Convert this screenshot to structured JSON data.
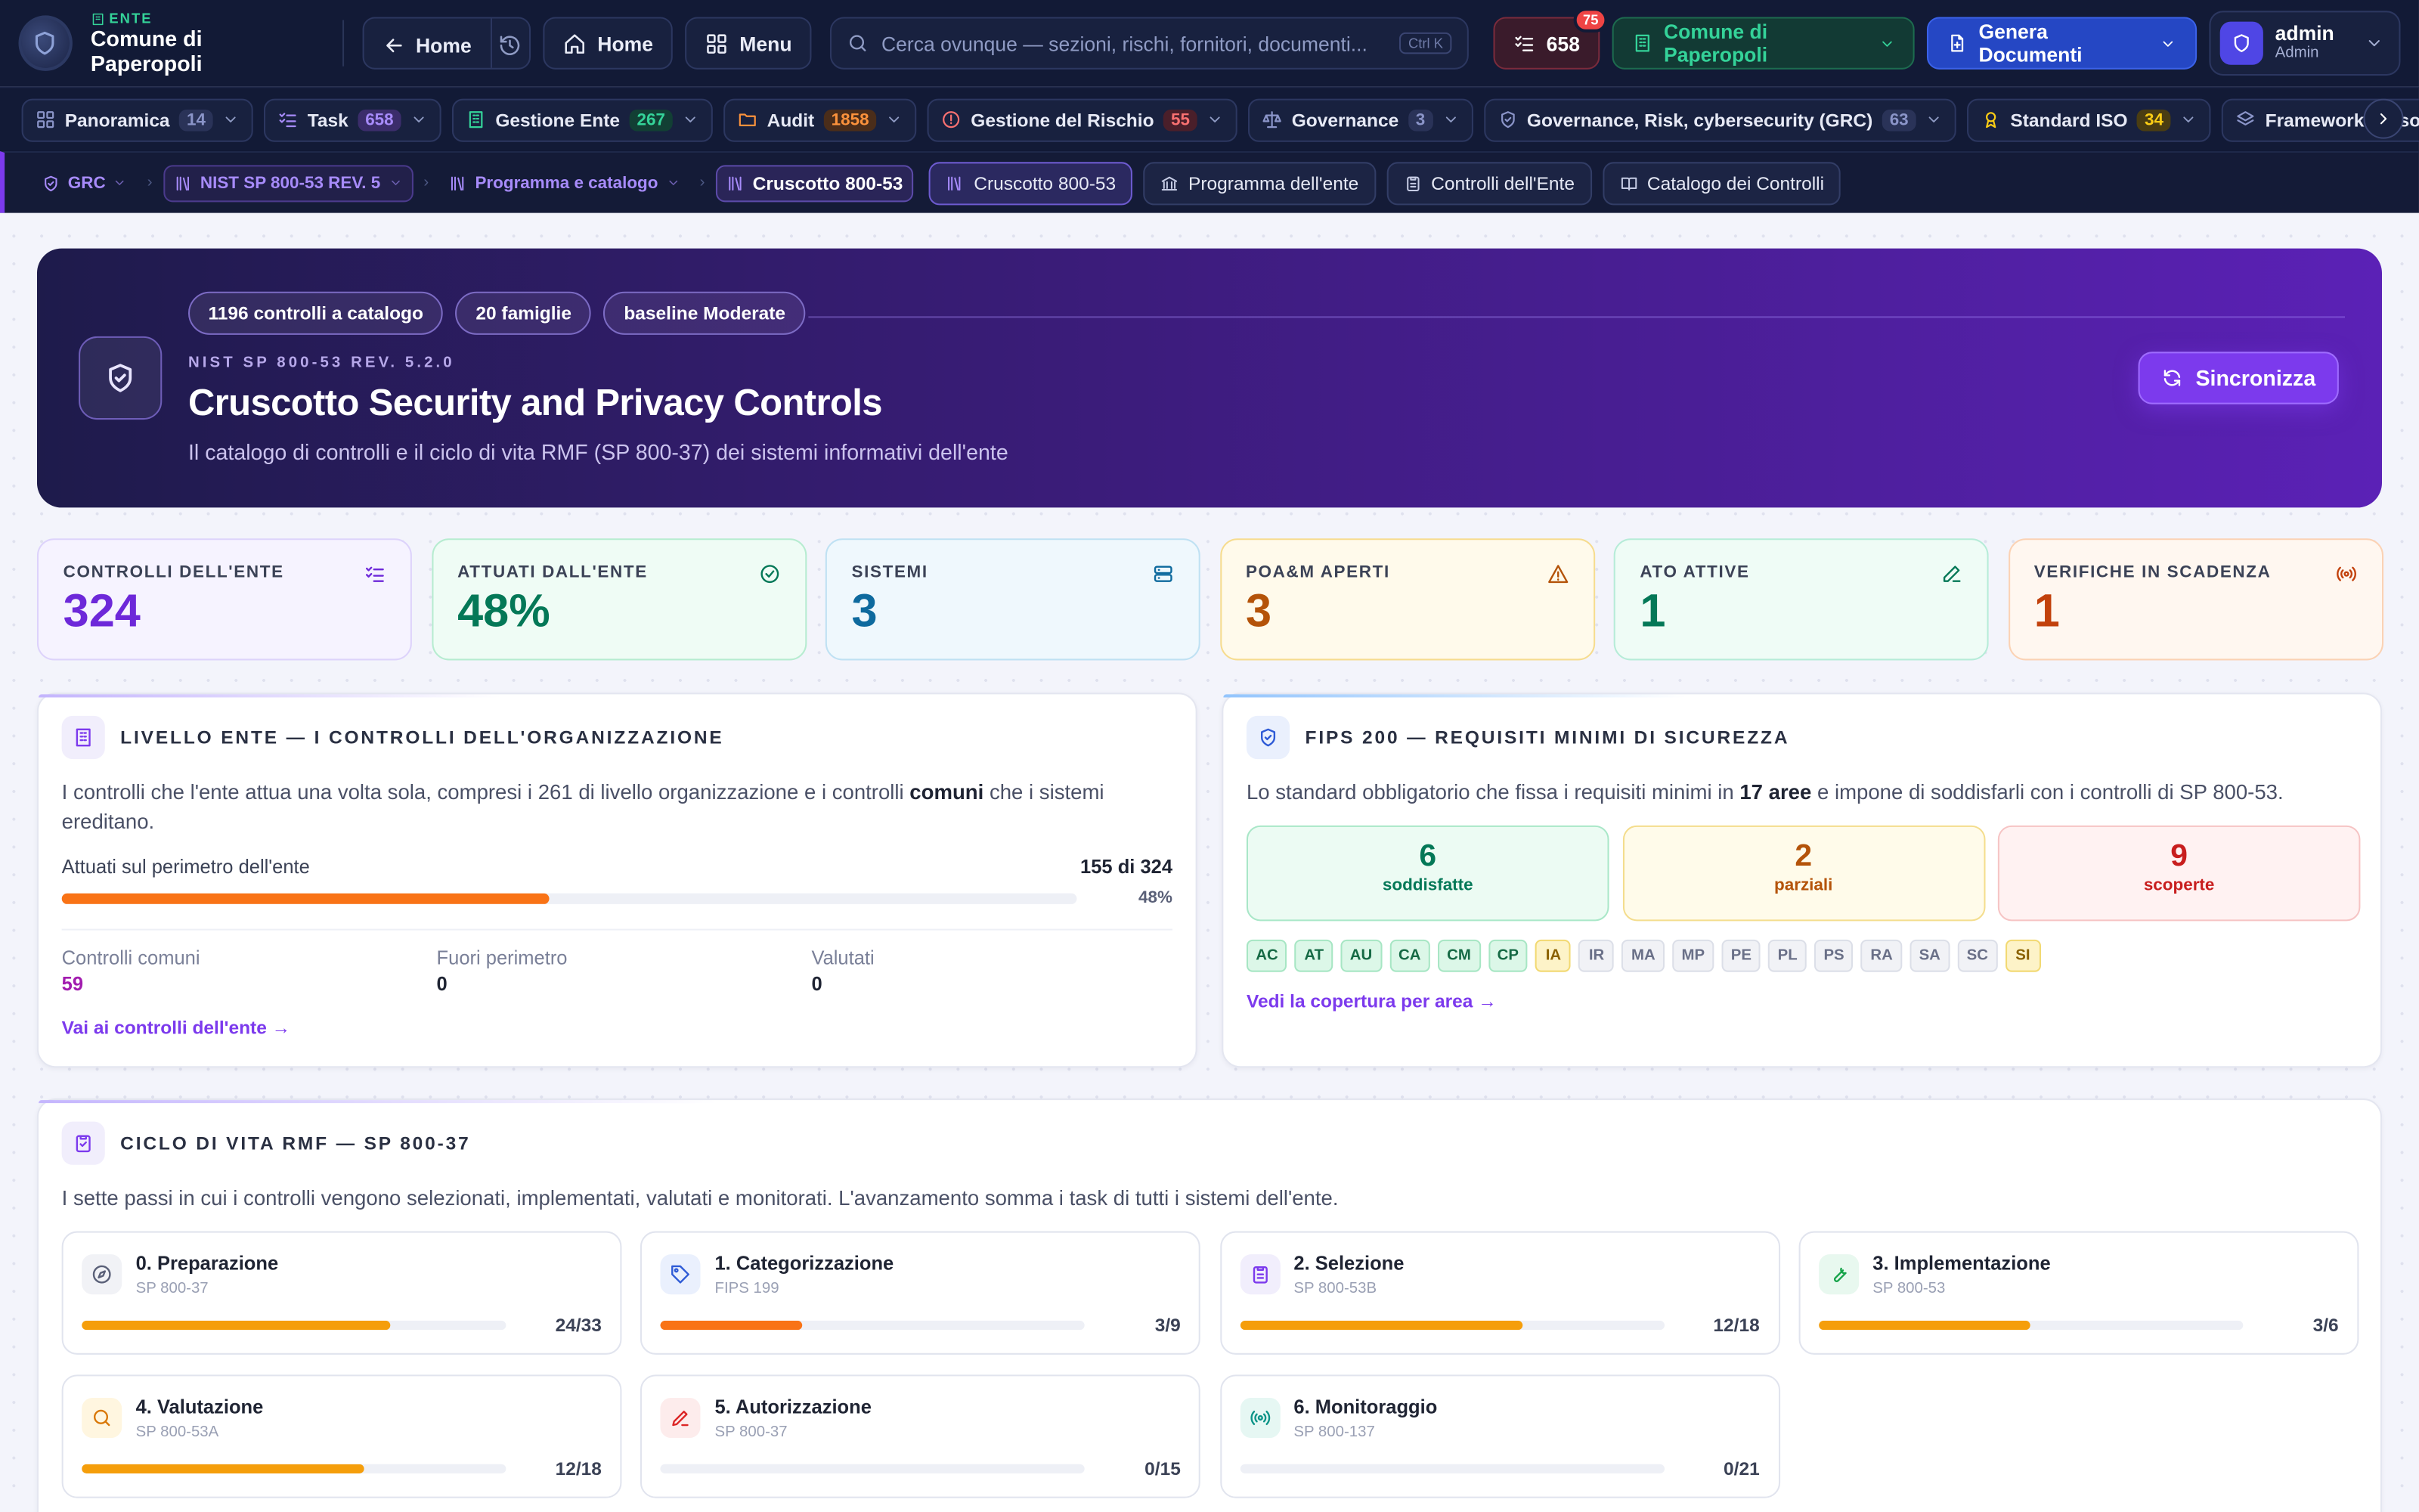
{
  "topbar": {
    "brand_tag": "ENTE",
    "brand_name": "Comune di Paperopoli",
    "home_back_label": "Home",
    "home_label": "Home",
    "menu_label": "Menu",
    "search_placeholder": "Cerca ovunque — sezioni, rischi, fornitori, documenti...",
    "search_shortcut": "Ctrl K",
    "tasks_count": "658",
    "tasks_badge": "75",
    "ente_label": "Comune di Paperopoli",
    "generate_label": "Genera Documenti",
    "user_name": "admin",
    "user_role": "Admin"
  },
  "modules": [
    {
      "label": "Panoramica",
      "count": "14",
      "icon": "grid-icon",
      "color": "#8b95c9",
      "cbg": "#2a3358"
    },
    {
      "label": "Task",
      "count": "658",
      "icon": "checklist-icon",
      "color": "#a78bfa",
      "cbg": "#3b2d6b"
    },
    {
      "label": "Gestione Ente",
      "count": "267",
      "icon": "building-icon",
      "color": "#34d399",
      "cbg": "#123f34"
    },
    {
      "label": "Audit",
      "count": "1858",
      "icon": "folder-icon",
      "color": "#fb923c",
      "cbg": "#4a2d1a"
    },
    {
      "label": "Gestione del Rischio",
      "count": "55",
      "icon": "alert-circle-icon",
      "color": "#f87171",
      "cbg": "#4a1f2a"
    },
    {
      "label": "Governance",
      "count": "3",
      "icon": "scale-icon",
      "color": "#8b95c9",
      "cbg": "#2a3358"
    },
    {
      "label": "Governance, Risk, cybersecurity (GRC)",
      "count": "63",
      "icon": "shield-check-icon",
      "color": "#8b95c9",
      "cbg": "#2a3358"
    },
    {
      "label": "Standard ISO",
      "count": "34",
      "icon": "award-icon",
      "color": "#facc15",
      "cbg": "#4a3d12"
    },
    {
      "label": "Framework Personalizzati",
      "count": "",
      "icon": "layers-icon",
      "color": "#8b95c9",
      "cbg": "#2a3358"
    }
  ],
  "breadcrumb": {
    "grc": "GRC",
    "nist": "NIST SP 800-53 REV. 5",
    "program": "Programma e catalogo",
    "current": "Cruscotto 800-53"
  },
  "quicklinks": [
    {
      "label": "Cruscotto 800-53",
      "icon": "library-icon"
    },
    {
      "label": "Programma dell'ente",
      "icon": "bank-icon"
    },
    {
      "label": "Controlli dell'Ente",
      "icon": "clipboard-icon"
    },
    {
      "label": "Catalogo dei Controlli",
      "icon": "book-icon"
    }
  ],
  "hero": {
    "tags": [
      "1196 controlli a catalogo",
      "20 famiglie",
      "baseline Moderate"
    ],
    "kicker": "NIST SP 800-53 REV. 5.2.0",
    "title": "Cruscotto Security and Privacy Controls",
    "subtitle": "Il catalogo di controlli e il ciclo di vita RMF (SP 800-37) dei sistemi informativi dell'ente",
    "sync_label": "Sincronizza"
  },
  "stats": [
    {
      "label": "CONTROLLI DELL'ENTE",
      "value": "324",
      "color": "#6d28d9",
      "bg": "#f6f3ff",
      "border": "#ddd3fb",
      "icon": "checklist-icon"
    },
    {
      "label": "ATTUATI DALL'ENTE",
      "value": "48%",
      "color": "#047857",
      "bg": "#effcf5",
      "border": "#b6ecd0",
      "icon": "check-circle-icon"
    },
    {
      "label": "SISTEMI",
      "value": "3",
      "color": "#0e6a9e",
      "bg": "#eff8fd",
      "border": "#bfe1f3",
      "icon": "server-icon"
    },
    {
      "label": "POA&M APERTI",
      "value": "3",
      "color": "#b45309",
      "bg": "#fffaeb",
      "border": "#f6dc8f",
      "icon": "warning-icon"
    },
    {
      "label": "ATO ATTIVE",
      "value": "1",
      "color": "#047857",
      "bg": "#effcf6",
      "border": "#b6ecd8",
      "icon": "pencil-icon"
    },
    {
      "label": "VERIFICHE IN SCADENZA",
      "value": "1",
      "color": "#c2410c",
      "bg": "#fff7f0",
      "border": "#fbd2b4",
      "icon": "broadcast-icon"
    }
  ],
  "ente": {
    "title": "LIVELLO ENTE — I CONTROLLI DELL'ORGANIZZAZIONE",
    "desc_pre": "I controlli che l'ente attua una volta sola, compresi i 261 di livello organizzazione e i controlli ",
    "desc_bold": "comuni",
    "desc_post": " che i sistemi ereditano.",
    "progress_label": "Attuati sul perimetro dell'ente",
    "progress_count": "155 di 324",
    "progress_pct": "48%",
    "progress_value": 0.48,
    "metrics": [
      {
        "label": "Controlli comuni",
        "value": "59",
        "color": "#a21caf"
      },
      {
        "label": "Fuori perimetro",
        "value": "0",
        "color": "#1f2433"
      },
      {
        "label": "Valutati",
        "value": "0",
        "color": "#1f2433"
      }
    ],
    "link": "Vai ai controlli dell'ente →"
  },
  "fips": {
    "title": "FIPS 200 — REQUISITI MINIMI DI SICUREZZA",
    "desc_pre": "Lo standard obbligatorio che fissa i requisiti minimi in ",
    "desc_bold": "17 aree",
    "desc_post": " e impone di soddisfarli con i controlli di SP 800-53.",
    "boxes": [
      {
        "value": "6",
        "label": "soddisfatte",
        "color": "#047857",
        "bg": "#ecfbf3",
        "border": "#a9e7c8"
      },
      {
        "value": "2",
        "label": "parziali",
        "color": "#b45309",
        "bg": "#fffbea",
        "border": "#f4dd8d"
      },
      {
        "value": "9",
        "label": "scoperte",
        "color": "#c81e1e",
        "bg": "#fff2f2",
        "border": "#f6c4c4"
      }
    ],
    "areas": [
      {
        "code": "AC",
        "status": "ok"
      },
      {
        "code": "AT",
        "status": "ok"
      },
      {
        "code": "AU",
        "status": "ok"
      },
      {
        "code": "CA",
        "status": "ok"
      },
      {
        "code": "CM",
        "status": "ok"
      },
      {
        "code": "CP",
        "status": "ok"
      },
      {
        "code": "IA",
        "status": "pa"
      },
      {
        "code": "IR",
        "status": "no"
      },
      {
        "code": "MA",
        "status": "no"
      },
      {
        "code": "MP",
        "status": "no"
      },
      {
        "code": "PE",
        "status": "no"
      },
      {
        "code": "PL",
        "status": "no"
      },
      {
        "code": "PS",
        "status": "no"
      },
      {
        "code": "RA",
        "status": "no"
      },
      {
        "code": "SA",
        "status": "no"
      },
      {
        "code": "SC",
        "status": "no"
      },
      {
        "code": "SI",
        "status": "pa"
      }
    ],
    "link": "Vedi la copertura per area →"
  },
  "rmf": {
    "title": "CICLO DI VITA RMF — SP 800-37",
    "desc": "I sette passi in cui i controlli vengono selezionati, implementati, valutati e monitorati. L'avanzamento somma i task di tutti i sistemi dell'ente.",
    "steps": [
      {
        "title": "0. Preparazione",
        "ref": "SP 800-37",
        "value": "24/33",
        "progress": 0.727,
        "icon": "compass-icon",
        "color": "#f59e0b",
        "ibg": "#f1f2f6",
        "ic": "#5a6078"
      },
      {
        "title": "1. Categorizzazione",
        "ref": "FIPS 199",
        "value": "3/9",
        "progress": 0.333,
        "icon": "tag-icon",
        "color": "#f97316",
        "ibg": "#eaf0fd",
        "ic": "#2f5bd6"
      },
      {
        "title": "2. Selezione",
        "ref": "SP 800-53B",
        "value": "12/18",
        "progress": 0.667,
        "icon": "clipboard-icon",
        "color": "#f59e0b",
        "ibg": "#f1eefc",
        "ic": "#7c3aed"
      },
      {
        "title": "3. Implementazione",
        "ref": "SP 800-53",
        "value": "3/6",
        "progress": 0.5,
        "icon": "wrench-icon",
        "color": "#f59e0b",
        "ibg": "#e8f8ef",
        "ic": "#16a34a"
      },
      {
        "title": "4. Valutazione",
        "ref": "SP 800-53A",
        "value": "12/18",
        "progress": 0.667,
        "icon": "search-icon",
        "color": "#f59e0b",
        "ibg": "#fff6e0",
        "ic": "#d97706"
      },
      {
        "title": "5. Autorizzazione",
        "ref": "SP 800-37",
        "value": "0/15",
        "progress": 0,
        "icon": "pen-icon",
        "color": "#f59e0b",
        "ibg": "#fdecec",
        "ic": "#dc2626"
      },
      {
        "title": "6. Monitoraggio",
        "ref": "SP 800-137",
        "value": "0/21",
        "progress": 0,
        "icon": "broadcast-icon",
        "color": "#f59e0b",
        "ibg": "#e6f7f3",
        "ic": "#0d9488"
      }
    ]
  }
}
